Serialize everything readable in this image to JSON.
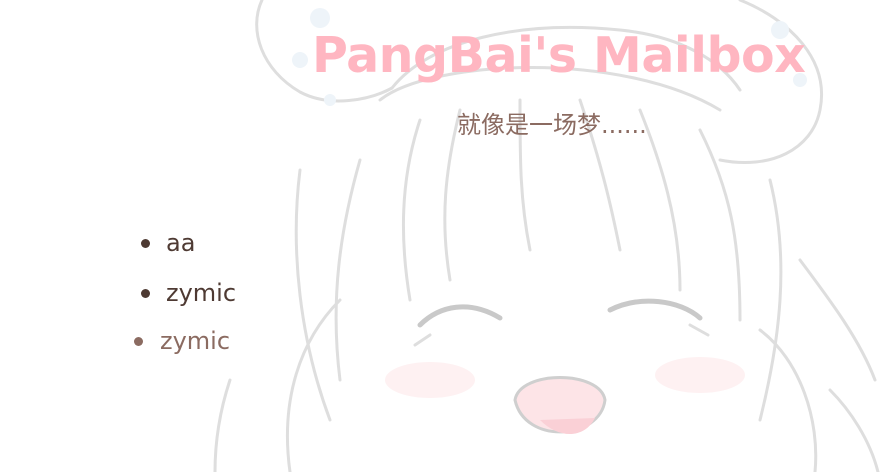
{
  "header": {
    "title": "PangBai's Mailbox",
    "subtitle": "就像是一场梦......"
  },
  "mail_list": {
    "items": [
      {
        "label": "aa",
        "state": "visited"
      },
      {
        "label": "zymic",
        "state": "visited"
      },
      {
        "label": "zymic",
        "state": "hover"
      }
    ]
  },
  "colors": {
    "title": "#ffb6c1",
    "subtitle": "#8b6b61",
    "item_default": "#4e3a33",
    "item_hover": "#8b6b61",
    "background_lines": "#d9d9d9",
    "background_blush": "#fde4e7"
  },
  "background": {
    "icon": "anime-girl-illustration"
  }
}
